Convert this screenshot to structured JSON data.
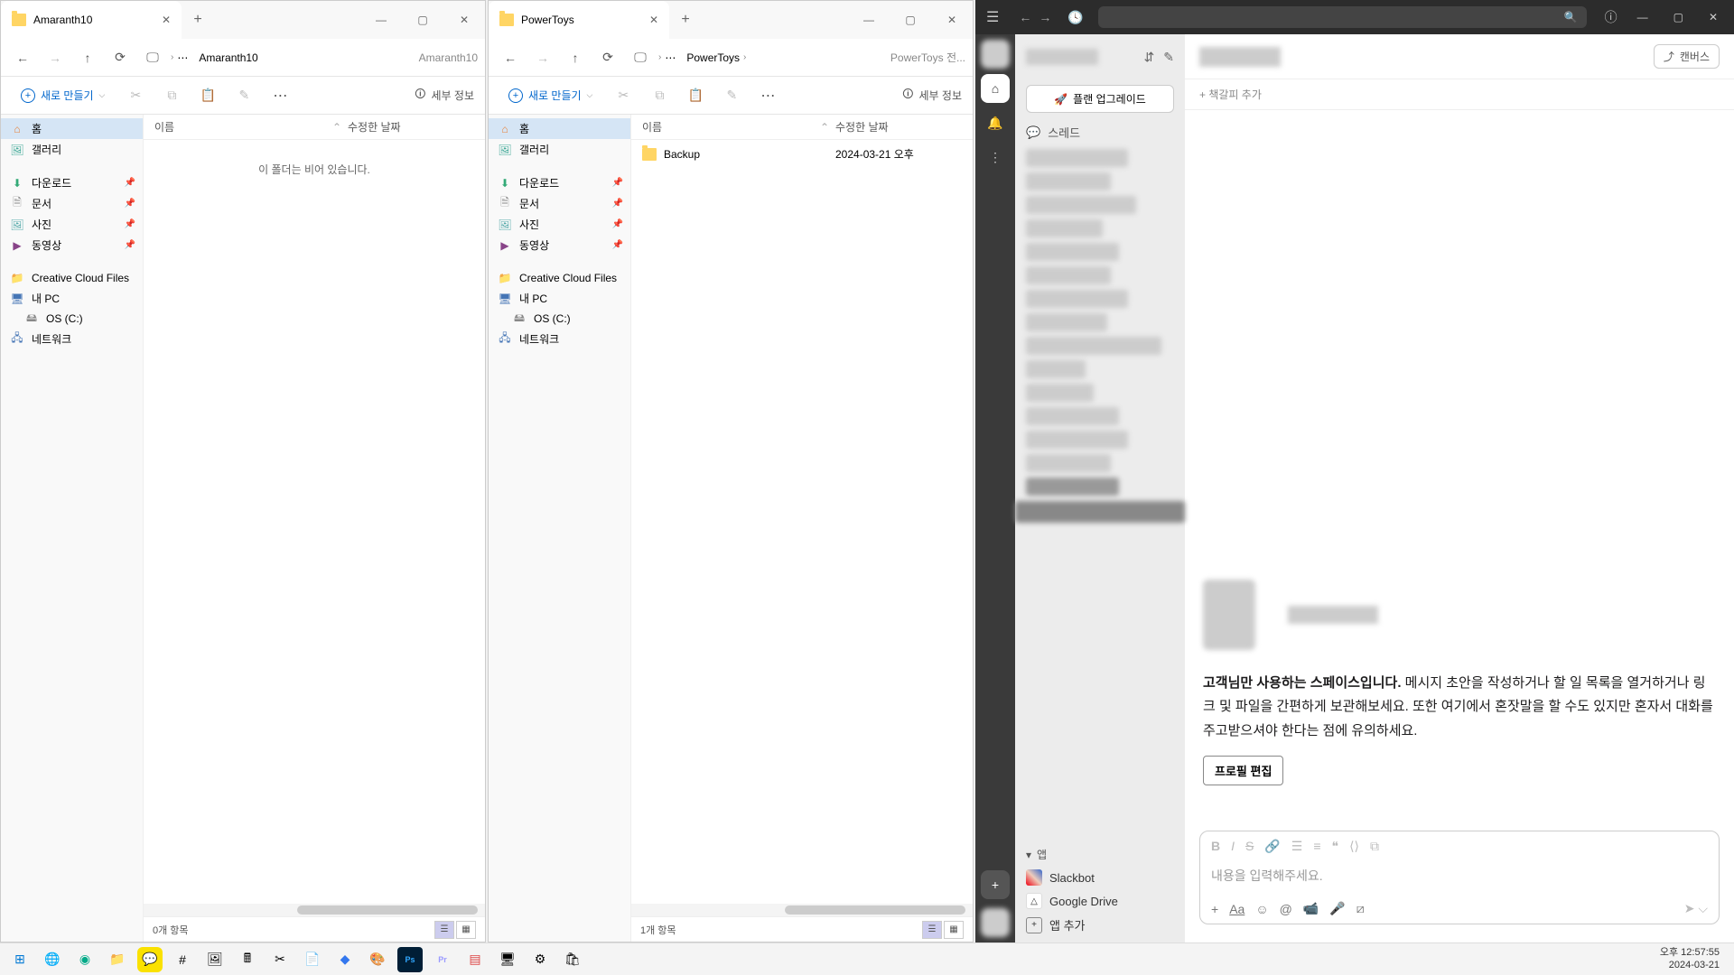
{
  "explorer1": {
    "tab_title": "Amaranth10",
    "crumb": "Amaranth10",
    "crumb_more": "Amaranth10",
    "new_btn": "새로 만들기",
    "detail": "세부 정보",
    "col_name": "이름",
    "col_date": "수정한 날짜",
    "empty": "이 폴더는 비어 있습니다.",
    "status": "0개 항목"
  },
  "explorer2": {
    "tab_title": "PowerToys",
    "crumb": "PowerToys",
    "crumb_more": "PowerToys 전...",
    "new_btn": "새로 만들기",
    "detail": "세부 정보",
    "col_name": "이름",
    "col_date": "수정한 날짜",
    "file_name": "Backup",
    "file_date": "2024-03-21 오후",
    "status": "1개 항목"
  },
  "sidebar": {
    "home": "홈",
    "gallery": "갤러리",
    "downloads": "다운로드",
    "documents": "문서",
    "pictures": "사진",
    "videos": "동영상",
    "ccf": "Creative Cloud Files",
    "pc": "내 PC",
    "osc": "OS (C:)",
    "network": "네트워크"
  },
  "slack": {
    "upgrade": "플랜 업그레이드",
    "threads": "스레드",
    "apps_header": "앱",
    "slackbot": "Slackbot",
    "gdrive": "Google Drive",
    "add_app": "앱 추가",
    "canvas": "캔버스",
    "bookmark": "+ 책갈피 추가",
    "welcome_bold": "고객님만 사용하는 스페이스입니다.",
    "welcome_rest": " 메시지 초안을 작성하거나 할 일 목록을 열거하거나 링크 및 파일을 간편하게 보관해보세요. 또한 여기에서 혼잣말을 할 수도 있지만 혼자서 대화를 주고받으셔야 한다는 점에 유의하세요.",
    "profile_edit": "프로필 편집",
    "composer_placeholder": "내용을 입력해주세요."
  },
  "taskbar": {
    "time": "오후 12:57:55",
    "date": "2024-03-21"
  },
  "colors": {
    "slack_purple": "#4a154b",
    "accent": "#0066cc"
  }
}
